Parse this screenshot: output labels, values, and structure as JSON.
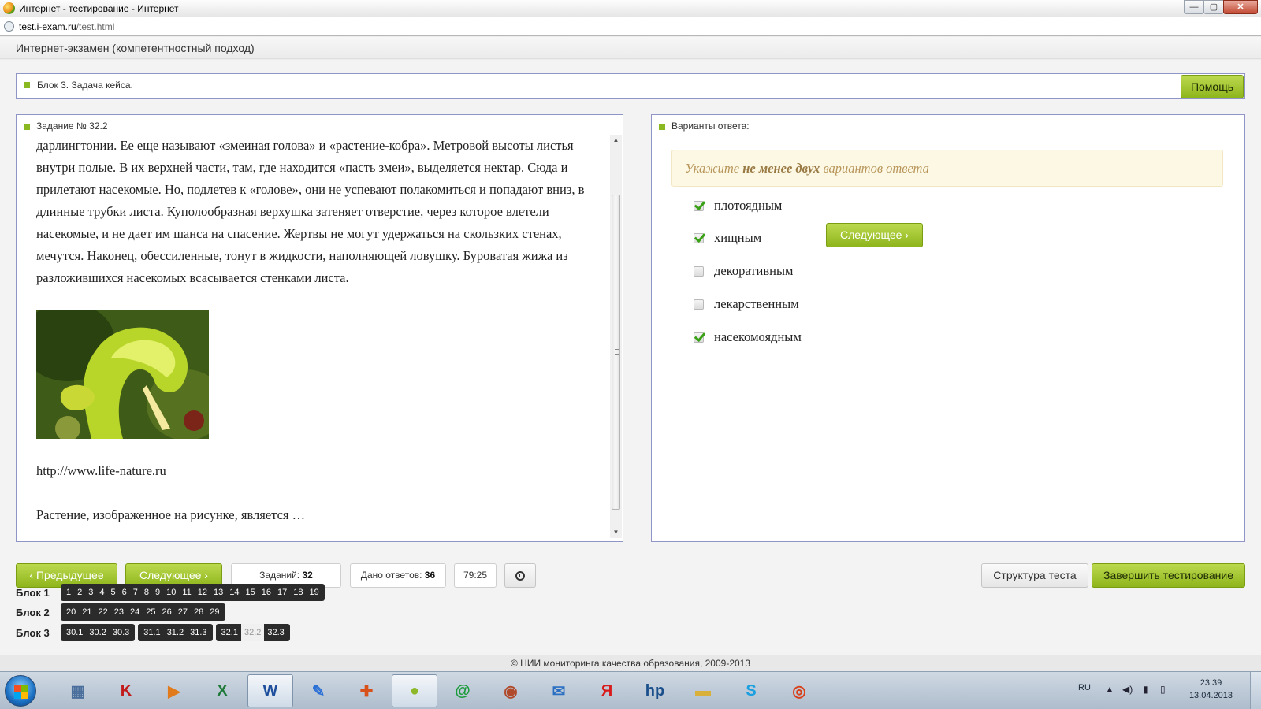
{
  "window": {
    "title": "Интернет - тестирование - Интернет",
    "buttons": {
      "minimize": "—",
      "maximize": "▢",
      "close": "✕"
    }
  },
  "address": {
    "host": "test.i-exam.ru",
    "path": "/test.html"
  },
  "page": {
    "title": "Интернет-экзамен (компетентностный подход)"
  },
  "block_bar": {
    "label": "Блок 3. Задача кейса.",
    "help_label": "Помощь"
  },
  "task": {
    "heading": "Задание № 32.2",
    "text": "дарлингтонии. Ее еще называют «змеиная голова» и «растение-кобра». Метровой высоты листья внутри полые. В их верхней части, там, где находится «пасть змеи», выделяется нектар. Сюда и прилетают насекомые. Но, подлетев к «голове», они не успевают полакомиться и попадают вниз, в длинные трубки листа. Куполообразная верхушка затеняет отверстие, через которое влетели насекомые, и не дает им шанса на спасение. Жертвы не могут удержаться на скользких стенах, мечутся. Наконец, обессиленные, тонут в жидкости, наполняющей ловушку. Буроватая жижа из разложившихся насекомых всасывается стенками листа.",
    "link": "http://www.life-nature.ru",
    "question": "Растение, изображенное на рисунке, является …"
  },
  "answers": {
    "heading": "Варианты ответа:",
    "hint_pre": "Укажите ",
    "hint_bold": "не менее двух",
    "hint_post": " вариантов ответа",
    "next_inline_label": "Следующее ›",
    "options": [
      {
        "label": "плотоядным",
        "checked": true
      },
      {
        "label": "хищным",
        "checked": true
      },
      {
        "label": "декоративным",
        "checked": false
      },
      {
        "label": "лекарственным",
        "checked": false
      },
      {
        "label": "насекомоядным",
        "checked": true
      }
    ]
  },
  "nav": {
    "prev_label": "‹ Предыдущее",
    "next_label": "Следующее ›",
    "tasks_label": "Заданий:",
    "tasks_count": "32",
    "answered_label": "Дано ответов:",
    "answered_count": "36",
    "timer": "79:25",
    "structure_label": "Структура теста",
    "finish_label": "Завершить тестирование"
  },
  "blocks": [
    {
      "label": "Блок 1",
      "groups": [
        [
          "1",
          "2",
          "3",
          "4",
          "5",
          "6",
          "7",
          "8",
          "9",
          "10",
          "11",
          "12",
          "13",
          "14",
          "15",
          "16",
          "17",
          "18",
          "19"
        ]
      ]
    },
    {
      "label": "Блок 2",
      "groups": [
        [
          "20",
          "21",
          "22",
          "23",
          "24",
          "25",
          "26",
          "27",
          "28",
          "29"
        ]
      ]
    },
    {
      "label": "Блок 3",
      "groups": [
        [
          "30.1",
          "30.2",
          "30.3"
        ],
        [
          "31.1",
          "31.2",
          "31.3"
        ],
        [
          "32.1",
          "32.2",
          "32.3"
        ]
      ]
    }
  ],
  "current_question": "32.2",
  "footer": "© НИИ мониторинга качества образования, 2009-2013",
  "taskbar": {
    "icons": [
      "calculator-icon",
      "kaspersky-icon",
      "media-player-icon",
      "excel-icon",
      "word-icon",
      "notes-icon",
      "office-tool-icon",
      "browser-app-icon",
      "mail-agent-icon",
      "globe-app-icon",
      "outlook-icon",
      "yandex-icon",
      "hp-icon",
      "folder-icon",
      "skype-icon",
      "chrome-icon"
    ],
    "language": "RU",
    "time": "23:39",
    "date": "13.04.2013"
  }
}
